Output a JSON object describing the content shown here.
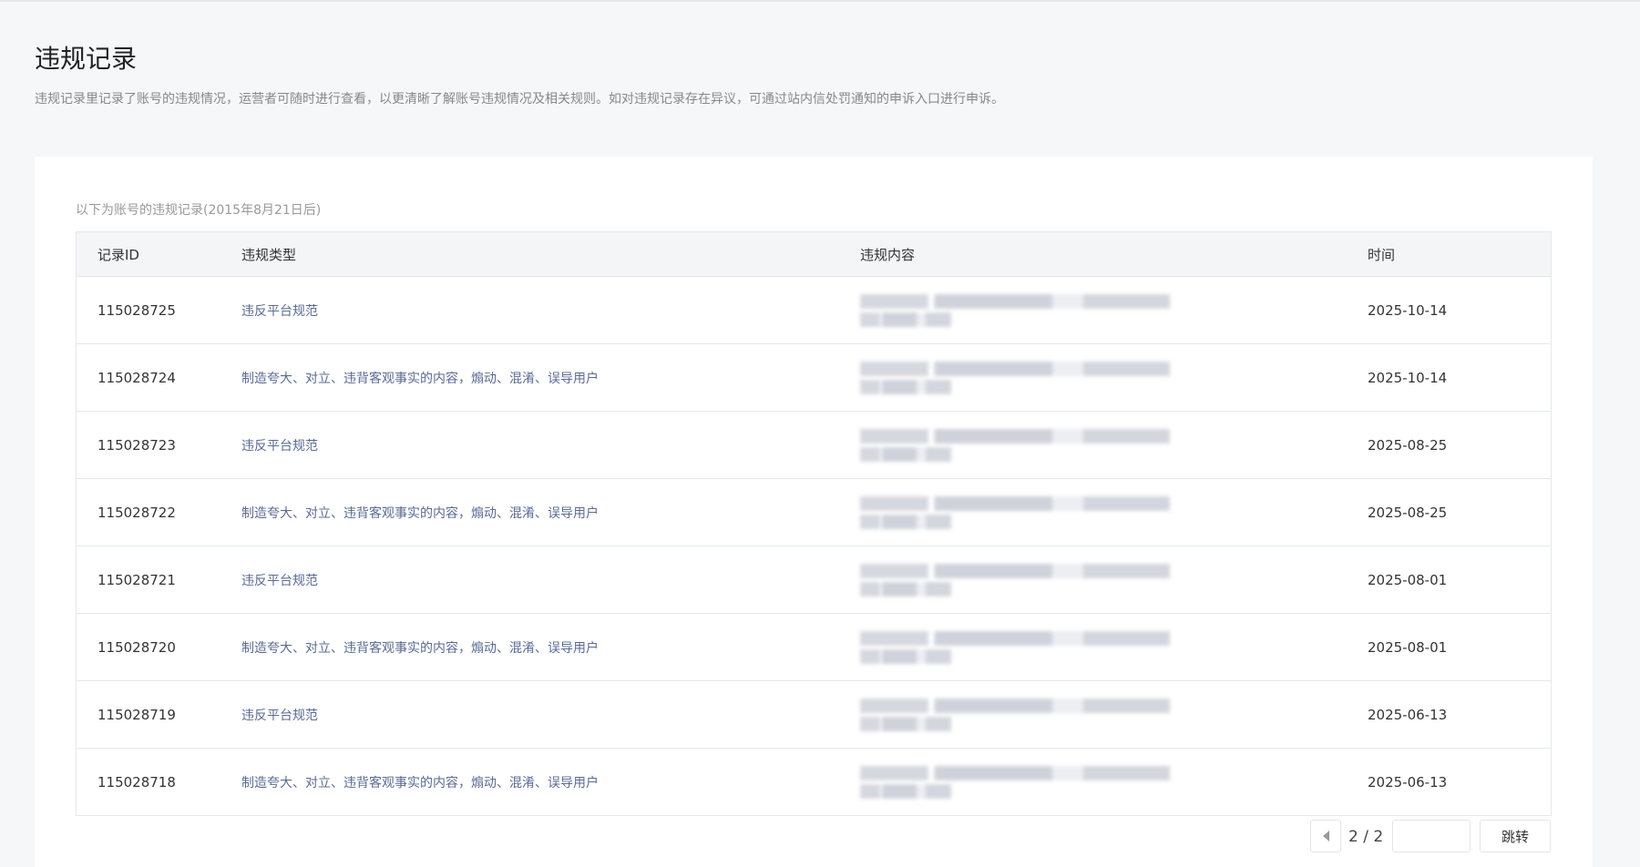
{
  "header": {
    "title": "违规记录",
    "description": "违规记录里记录了账号的违规情况，运营者可随时进行查看，以更清晰了解账号违规情况及相关规则。如对违规记录存在异议，可通过站内信处罚通知的申诉入口进行申诉。"
  },
  "card": {
    "subtitle": "以下为账号的违规记录(2015年8月21日后)"
  },
  "table": {
    "columns": [
      "记录ID",
      "违规类型",
      "违规内容",
      "时间"
    ],
    "rows": [
      {
        "id": "115028725",
        "type": "违反平台规范",
        "date": "2025-10-14"
      },
      {
        "id": "115028724",
        "type": "制造夸大、对立、违背客观事实的内容，煽动、混淆、误导用户",
        "date": "2025-10-14"
      },
      {
        "id": "115028723",
        "type": "违反平台规范",
        "date": "2025-08-25"
      },
      {
        "id": "115028722",
        "type": "制造夸大、对立、违背客观事实的内容，煽动、混淆、误导用户",
        "date": "2025-08-25"
      },
      {
        "id": "115028721",
        "type": "违反平台规范",
        "date": "2025-08-01"
      },
      {
        "id": "115028720",
        "type": "制造夸大、对立、违背客观事实的内容，煽动、混淆、误导用户",
        "date": "2025-08-01"
      },
      {
        "id": "115028719",
        "type": "违反平台规范",
        "date": "2025-06-13"
      },
      {
        "id": "115028718",
        "type": "制造夸大、对立、违背客观事实的内容，煽动、混淆、误导用户",
        "date": "2025-06-13"
      }
    ]
  },
  "pagination": {
    "page_text": "2 / 2",
    "jump_input_value": "",
    "jump_label": "跳转"
  }
}
